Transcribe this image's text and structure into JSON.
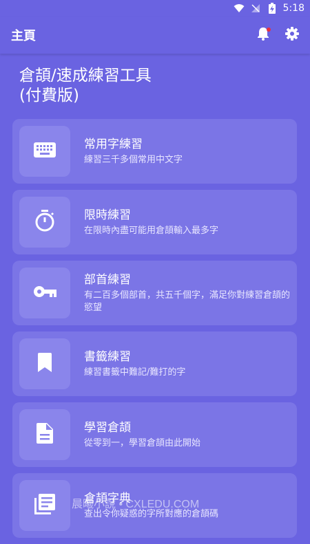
{
  "status_bar": {
    "time": "5:18"
  },
  "app_bar": {
    "title": "主頁"
  },
  "headline": {
    "line1": "倉頡/速成練習工具",
    "line2": "(付費版)"
  },
  "cards": [
    {
      "icon": "keyboard-icon",
      "title": "常用字練習",
      "subtitle": "練習三千多個常用中文字"
    },
    {
      "icon": "timer-icon",
      "title": "限時練習",
      "subtitle": "在限時內盡可能用倉頡輸入最多字"
    },
    {
      "icon": "key-icon",
      "title": "部首練習",
      "subtitle": "有二百多個部首，共五千個字，滿足你對練習倉頡的慾望"
    },
    {
      "icon": "bookmark-icon",
      "title": "書籤練習",
      "subtitle": "練習書籤中難記/難打的字"
    },
    {
      "icon": "document-icon",
      "title": "學習倉頡",
      "subtitle": "從零到一，學習倉頡由此開始"
    },
    {
      "icon": "dictionary-icon",
      "title": "倉頡字典",
      "subtitle": "查出令你疑惑的字所對應的倉頡碼"
    }
  ],
  "watermark": {
    "text": "晨曦小說 • CXLEDU.COM"
  }
}
